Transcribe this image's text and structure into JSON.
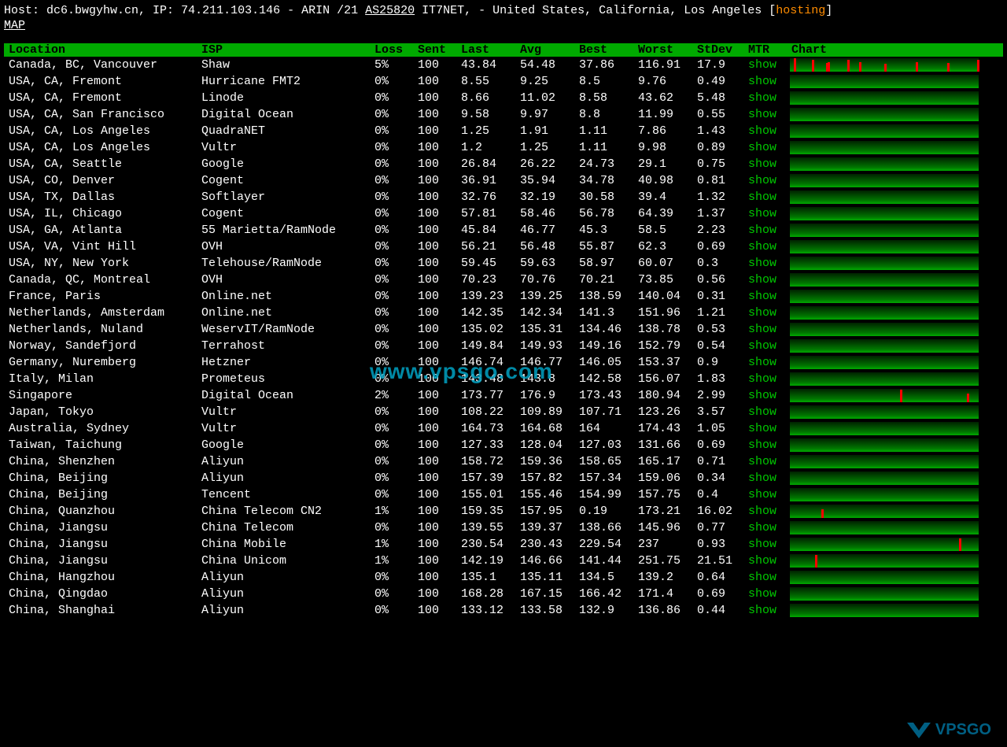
{
  "header": {
    "host_label": "Host: ",
    "host": "dc6.bwgyhw.cn",
    "ip_label": ", IP: ",
    "ip": "74.211.103.146",
    "registry": " - ARIN /21 ",
    "asn": "AS25820",
    "asn_name": " IT7NET, - United States, California, Los Angeles [",
    "hosting": "hosting",
    "close_bracket": "]",
    "map": "MAP"
  },
  "columns": {
    "location": "Location",
    "isp": "ISP",
    "loss": "Loss",
    "sent": "Sent",
    "last": "Last",
    "avg": "Avg",
    "best": "Best",
    "worst": "Worst",
    "stdev": "StDev",
    "mtr": "MTR",
    "chart": "Chart"
  },
  "show_label": "show",
  "rows": [
    {
      "location": "Canada, BC, Vancouver",
      "isp": "Shaw",
      "loss": "5%",
      "sent": "100",
      "last": "43.84",
      "avg": "54.48",
      "best": "37.86",
      "worst": "116.91",
      "stdev": "17.9",
      "spikes": [
        5,
        28,
        46,
        48,
        73,
        88,
        120,
        160,
        200,
        238
      ]
    },
    {
      "location": "USA, CA, Fremont",
      "isp": "Hurricane FMT2",
      "loss": "0%",
      "sent": "100",
      "last": "8.55",
      "avg": "9.25",
      "best": "8.5",
      "worst": "9.76",
      "stdev": "0.49",
      "spikes": []
    },
    {
      "location": "USA, CA, Fremont",
      "isp": "Linode",
      "loss": "0%",
      "sent": "100",
      "last": "8.66",
      "avg": "11.02",
      "best": "8.58",
      "worst": "43.62",
      "stdev": "5.48",
      "spikes": []
    },
    {
      "location": "USA, CA, San Francisco",
      "isp": "Digital Ocean",
      "loss": "0%",
      "sent": "100",
      "last": "9.58",
      "avg": "9.97",
      "best": "8.8",
      "worst": "11.99",
      "stdev": "0.55",
      "spikes": []
    },
    {
      "location": "USA, CA, Los Angeles",
      "isp": "QuadraNET",
      "loss": "0%",
      "sent": "100",
      "last": "1.25",
      "avg": "1.91",
      "best": "1.11",
      "worst": "7.86",
      "stdev": "1.43",
      "spikes": []
    },
    {
      "location": "USA, CA, Los Angeles",
      "isp": "Vultr",
      "loss": "0%",
      "sent": "100",
      "last": "1.2",
      "avg": "1.25",
      "best": "1.11",
      "worst": "9.98",
      "stdev": "0.89",
      "spikes": []
    },
    {
      "location": "USA, CA, Seattle",
      "isp": "Google",
      "loss": "0%",
      "sent": "100",
      "last": "26.84",
      "avg": "26.22",
      "best": "24.73",
      "worst": "29.1",
      "stdev": "0.75",
      "spikes": []
    },
    {
      "location": "USA, CO, Denver",
      "isp": "Cogent",
      "loss": "0%",
      "sent": "100",
      "last": "36.91",
      "avg": "35.94",
      "best": "34.78",
      "worst": "40.98",
      "stdev": "0.81",
      "spikes": []
    },
    {
      "location": "USA, TX, Dallas",
      "isp": "Softlayer",
      "loss": "0%",
      "sent": "100",
      "last": "32.76",
      "avg": "32.19",
      "best": "30.58",
      "worst": "39.4",
      "stdev": "1.32",
      "spikes": []
    },
    {
      "location": "USA, IL, Chicago",
      "isp": "Cogent",
      "loss": "0%",
      "sent": "100",
      "last": "57.81",
      "avg": "58.46",
      "best": "56.78",
      "worst": "64.39",
      "stdev": "1.37",
      "spikes": []
    },
    {
      "location": "USA, GA, Atlanta",
      "isp": "55 Marietta/RamNode",
      "loss": "0%",
      "sent": "100",
      "last": "45.84",
      "avg": "46.77",
      "best": "45.3",
      "worst": "58.5",
      "stdev": "2.23",
      "spikes": []
    },
    {
      "location": "USA, VA, Vint Hill",
      "isp": "OVH",
      "loss": "0%",
      "sent": "100",
      "last": "56.21",
      "avg": "56.48",
      "best": "55.87",
      "worst": "62.3",
      "stdev": "0.69",
      "spikes": []
    },
    {
      "location": "USA, NY, New York",
      "isp": "Telehouse/RamNode",
      "loss": "0%",
      "sent": "100",
      "last": "59.45",
      "avg": "59.63",
      "best": "58.97",
      "worst": "60.07",
      "stdev": "0.3",
      "spikes": []
    },
    {
      "location": "Canada, QC, Montreal",
      "isp": "OVH",
      "loss": "0%",
      "sent": "100",
      "last": "70.23",
      "avg": "70.76",
      "best": "70.21",
      "worst": "73.85",
      "stdev": "0.56",
      "spikes": []
    },
    {
      "location": "France, Paris",
      "isp": "Online.net",
      "loss": "0%",
      "sent": "100",
      "last": "139.23",
      "avg": "139.25",
      "best": "138.59",
      "worst": "140.04",
      "stdev": "0.31",
      "spikes": []
    },
    {
      "location": "Netherlands, Amsterdam",
      "isp": "Online.net",
      "loss": "0%",
      "sent": "100",
      "last": "142.35",
      "avg": "142.34",
      "best": "141.3",
      "worst": "151.96",
      "stdev": "1.21",
      "spikes": []
    },
    {
      "location": "Netherlands, Nuland",
      "isp": "WeservIT/RamNode",
      "loss": "0%",
      "sent": "100",
      "last": "135.02",
      "avg": "135.31",
      "best": "134.46",
      "worst": "138.78",
      "stdev": "0.53",
      "spikes": []
    },
    {
      "location": "Norway, Sandefjord",
      "isp": "Terrahost",
      "loss": "0%",
      "sent": "100",
      "last": "149.84",
      "avg": "149.93",
      "best": "149.16",
      "worst": "152.79",
      "stdev": "0.54",
      "spikes": []
    },
    {
      "location": "Germany, Nuremberg",
      "isp": "Hetzner",
      "loss": "0%",
      "sent": "100",
      "last": "146.74",
      "avg": "146.77",
      "best": "146.05",
      "worst": "153.37",
      "stdev": "0.9",
      "spikes": []
    },
    {
      "location": "Italy, Milan",
      "isp": "Prometeus",
      "loss": "0%",
      "sent": "100",
      "last": "143.48",
      "avg": "143.8",
      "best": "142.58",
      "worst": "156.07",
      "stdev": "1.83",
      "spikes": []
    },
    {
      "location": "Singapore",
      "isp": "Digital Ocean",
      "loss": "2%",
      "sent": "100",
      "last": "173.77",
      "avg": "176.9",
      "best": "173.43",
      "worst": "180.94",
      "stdev": "2.99",
      "spikes": [
        140,
        225
      ]
    },
    {
      "location": "Japan, Tokyo",
      "isp": "Vultr",
      "loss": "0%",
      "sent": "100",
      "last": "108.22",
      "avg": "109.89",
      "best": "107.71",
      "worst": "123.26",
      "stdev": "3.57",
      "spikes": []
    },
    {
      "location": "Australia, Sydney",
      "isp": "Vultr",
      "loss": "0%",
      "sent": "100",
      "last": "164.73",
      "avg": "164.68",
      "best": "164",
      "worst": "174.43",
      "stdev": "1.05",
      "spikes": []
    },
    {
      "location": "Taiwan, Taichung",
      "isp": "Google",
      "loss": "0%",
      "sent": "100",
      "last": "127.33",
      "avg": "128.04",
      "best": "127.03",
      "worst": "131.66",
      "stdev": "0.69",
      "spikes": []
    },
    {
      "location": "China, Shenzhen",
      "isp": "Aliyun",
      "loss": "0%",
      "sent": "100",
      "last": "158.72",
      "avg": "159.36",
      "best": "158.65",
      "worst": "165.17",
      "stdev": "0.71",
      "spikes": []
    },
    {
      "location": "China, Beijing",
      "isp": "Aliyun",
      "loss": "0%",
      "sent": "100",
      "last": "157.39",
      "avg": "157.82",
      "best": "157.34",
      "worst": "159.06",
      "stdev": "0.34",
      "spikes": []
    },
    {
      "location": "China, Beijing",
      "isp": "Tencent",
      "loss": "0%",
      "sent": "100",
      "last": "155.01",
      "avg": "155.46",
      "best": "154.99",
      "worst": "157.75",
      "stdev": "0.4",
      "spikes": []
    },
    {
      "location": "China, Quanzhou",
      "isp": "China Telecom CN2",
      "loss": "1%",
      "sent": "100",
      "last": "159.35",
      "avg": "157.95",
      "best": "0.19",
      "worst": "173.21",
      "stdev": "16.02",
      "spikes": [
        40
      ]
    },
    {
      "location": "China, Jiangsu",
      "isp": "China Telecom",
      "loss": "0%",
      "sent": "100",
      "last": "139.55",
      "avg": "139.37",
      "best": "138.66",
      "worst": "145.96",
      "stdev": "0.77",
      "spikes": []
    },
    {
      "location": "China, Jiangsu",
      "isp": "China Mobile",
      "loss": "1%",
      "sent": "100",
      "last": "230.54",
      "avg": "230.43",
      "best": "229.54",
      "worst": "237",
      "stdev": "0.93",
      "spikes": [
        215
      ]
    },
    {
      "location": "China, Jiangsu",
      "isp": "China Unicom",
      "loss": "1%",
      "sent": "100",
      "last": "142.19",
      "avg": "146.66",
      "best": "141.44",
      "worst": "251.75",
      "stdev": "21.51",
      "spikes": [
        32
      ]
    },
    {
      "location": "China, Hangzhou",
      "isp": "Aliyun",
      "loss": "0%",
      "sent": "100",
      "last": "135.1",
      "avg": "135.11",
      "best": "134.5",
      "worst": "139.2",
      "stdev": "0.64",
      "spikes": []
    },
    {
      "location": "China, Qingdao",
      "isp": "Aliyun",
      "loss": "0%",
      "sent": "100",
      "last": "168.28",
      "avg": "167.15",
      "best": "166.42",
      "worst": "171.4",
      "stdev": "0.69",
      "spikes": []
    },
    {
      "location": "China, Shanghai",
      "isp": "Aliyun",
      "loss": "0%",
      "sent": "100",
      "last": "133.12",
      "avg": "133.58",
      "best": "132.9",
      "worst": "136.86",
      "stdev": "0.44",
      "spikes": []
    }
  ],
  "watermark_main": "www.vpsgo.com",
  "watermark_logo": "VPSGO"
}
